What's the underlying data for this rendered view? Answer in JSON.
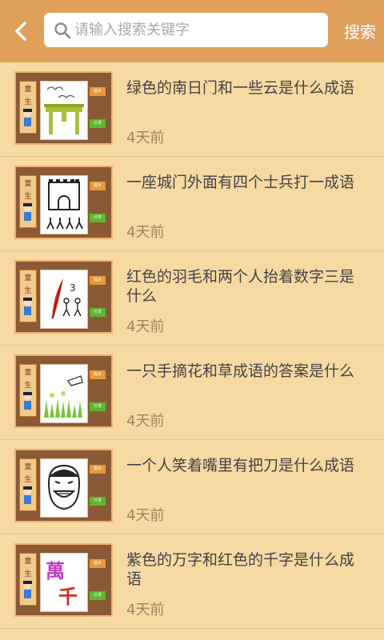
{
  "header": {
    "search_placeholder": "请输入搜索关键字",
    "search_button": "搜索"
  },
  "thumb_labels": {
    "side_a": "童",
    "side_b": "生",
    "tag_top": "提示",
    "tag_bottom": "分享"
  },
  "items": [
    {
      "title": "绿色的南日门和一些云是什么成语",
      "time": "4天前",
      "illustration": "gate-clouds"
    },
    {
      "title": "一座城门外面有四个士兵打一成语",
      "time": "4天前",
      "illustration": "citygate-soldiers"
    },
    {
      "title": "红色的羽毛和两个人抬着数字三是什么",
      "time": "4天前",
      "illustration": "feather-three"
    },
    {
      "title": "一只手摘花和草成语的答案是什么",
      "time": "4天前",
      "illustration": "hand-flowers"
    },
    {
      "title": "一个人笑着嘴里有把刀是什么成语",
      "time": "4天前",
      "illustration": "laughing-face-knife"
    },
    {
      "title": "紫色的万字和红色的千字是什么成语",
      "time": "4天前",
      "illustration": "wan-qian-chars",
      "chars": [
        "萬",
        "千"
      ]
    }
  ]
}
